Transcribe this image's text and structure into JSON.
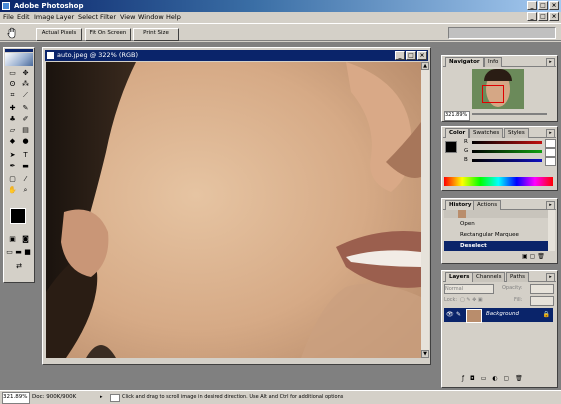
{
  "app": {
    "title": "Adobe Photoshop"
  },
  "menu": [
    "File",
    "Edit",
    "Image",
    "Layer",
    "Select",
    "Filter",
    "View",
    "Window",
    "Help"
  ],
  "options": {
    "actual_pixels": "Actual Pixels",
    "fit_on_screen": "Fit On Screen",
    "print_size": "Print Size"
  },
  "document": {
    "title": "auto.jpeg @ 322% (RGB)"
  },
  "navigator": {
    "tabs": [
      "Navigator",
      "Info"
    ],
    "zoom": "321.89%"
  },
  "color": {
    "tabs": [
      "Color",
      "Swatches",
      "Styles"
    ],
    "channels": [
      {
        "label": "R",
        "value": "",
        "color": "#c01010"
      },
      {
        "label": "G",
        "value": "",
        "color": "#10a010"
      },
      {
        "label": "B",
        "value": "",
        "color": "#1010c0"
      }
    ],
    "foreground": "#000000",
    "background": "#ffffff"
  },
  "history": {
    "tabs": [
      "History",
      "Actions"
    ],
    "items": [
      "Open",
      "Rectangular Marquee",
      "Deselect"
    ],
    "selected_index": 2
  },
  "layers": {
    "tabs": [
      "Layers",
      "Channels",
      "Paths"
    ],
    "blend_mode": "Normal",
    "opacity_label": "Opacity:",
    "lock_label": "Lock:",
    "fill_label": "Fill:",
    "layer_name": "Background"
  },
  "status": {
    "zoom": "321.89%",
    "doc": "Doc: 900K/900K",
    "hint": "Click and drag to scroll image in desired direction. Use Alt and Ctrl for additional options"
  },
  "colors": {
    "title_active": "#0a246a",
    "chrome": "#d4d0c8",
    "workspace": "#808080",
    "selection": "#0a246a"
  }
}
